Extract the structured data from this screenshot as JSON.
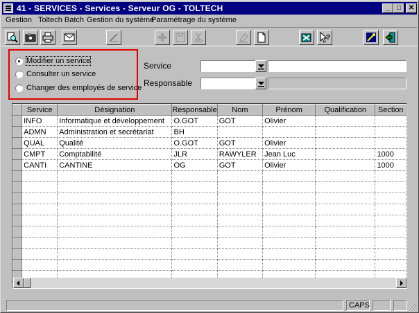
{
  "window": {
    "title": "41 - SERVICES - Services - Serveur OG - TOLTECH",
    "min_glyph": "_",
    "max_glyph": "□",
    "close_glyph": "✕"
  },
  "menu": {
    "items": [
      "Gestion",
      "Toltech Batch",
      "Gestion du système",
      "Paramétrage du système"
    ]
  },
  "toolbar": {
    "icons": [
      "search-icon",
      "camera-icon",
      "print-icon",
      "mail-icon",
      "edit-icon",
      "add-icon",
      "save-icon",
      "cut-icon",
      "erase-icon",
      "new-page-icon",
      "convert-icon",
      "help-pointer-icon",
      "wizard-icon",
      "exit-icon"
    ]
  },
  "options": {
    "items": [
      {
        "label": "Modifier un service",
        "selected": true
      },
      {
        "label": "Consulter un service",
        "selected": false
      },
      {
        "label": "Changer des employés de service",
        "selected": false
      }
    ]
  },
  "form": {
    "service_label": "Service",
    "service_value": "",
    "responsable_label": "Responsable",
    "responsable_value": ""
  },
  "table": {
    "columns": [
      "Service",
      "Désignation",
      "Responsable",
      "Nom",
      "Prénom",
      "Qualification",
      "Section"
    ],
    "rows": [
      [
        "INFO",
        "Informatique et développement",
        "O.GOT",
        "GOT",
        "Olivier",
        "",
        ""
      ],
      [
        "ADMN",
        "Administration et secrétariat",
        "BH",
        "",
        "",
        "",
        ""
      ],
      [
        "QUAL",
        "Qualité",
        "O.GOT",
        "GOT",
        "Olivier",
        "",
        ""
      ],
      [
        "CMPT",
        "Comptabilité",
        "JLR",
        "RAWYLER",
        "Jean Luc",
        "",
        "1000"
      ],
      [
        "CANTI",
        "CANTINE",
        "OG",
        "GOT",
        "Olivier",
        "",
        "1000"
      ]
    ],
    "total_rows": 15
  },
  "status": {
    "caps": "CAPS"
  },
  "colors": {
    "title_bar": "#000080",
    "face": "#c0c0c0",
    "highlight_box": "#e00000"
  }
}
